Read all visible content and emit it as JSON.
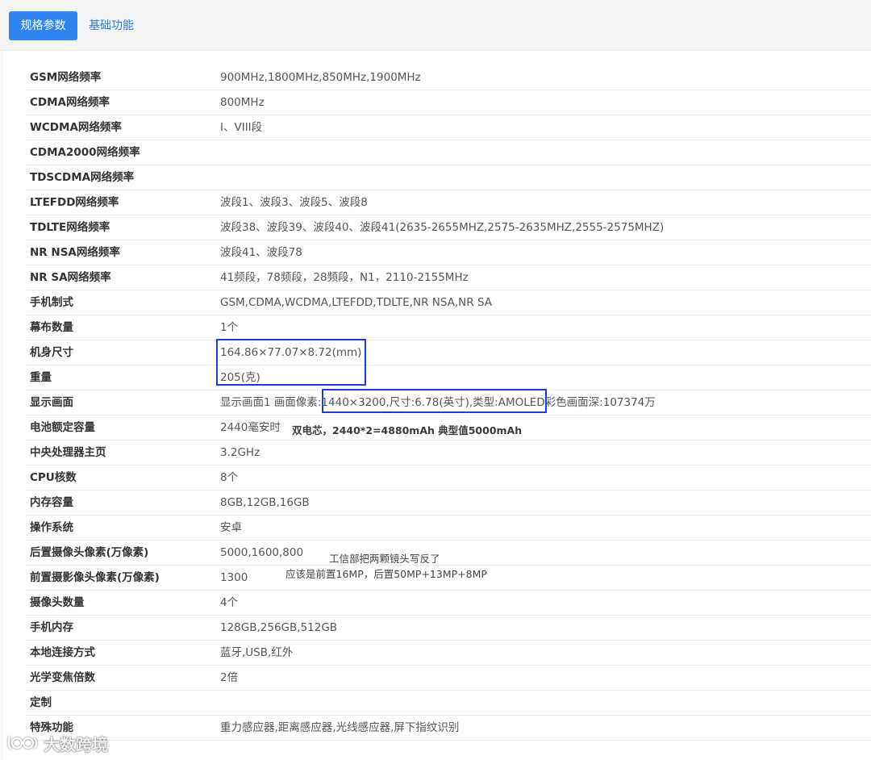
{
  "tabs": {
    "specs": "规格参数",
    "basic": "基础功能"
  },
  "rows": [
    {
      "label": "GSM网络频率",
      "value": "900MHz,1800MHz,850MHz,1900MHz"
    },
    {
      "label": "CDMA网络频率",
      "value": "800MHz"
    },
    {
      "label": "WCDMA网络频率",
      "value": "I、VIII段"
    },
    {
      "label": "CDMA2000网络频率",
      "value": ""
    },
    {
      "label": "TDSCDMA网络频率",
      "value": ""
    },
    {
      "label": "LTEFDD网络频率",
      "value": "波段1、波段3、波段5、波段8"
    },
    {
      "label": "TDLTE网络频率",
      "value": "波段38、波段39、波段40、波段41(2635-2655MHZ,2575-2635MHZ,2555-2575MHZ)"
    },
    {
      "label": "NR NSA网络频率",
      "value": "波段41、波段78"
    },
    {
      "label": "NR SA网络频率",
      "value": "41频段，78频段，28频段，N1，2110-2155MHz"
    },
    {
      "label": "手机制式",
      "value": "GSM,CDMA,WCDMA,LTEFDD,TDLTE,NR NSA,NR SA"
    },
    {
      "label": "幕布数量",
      "value": "1个"
    },
    {
      "label": "机身尺寸",
      "value": "164.86×77.07×8.72(mm)"
    },
    {
      "label": "重量",
      "value": "205(克)"
    },
    {
      "label": "显示画面",
      "value": "显示画面1 画面像素:1440×3200,尺寸:6.78(英寸),类型:AMOLED彩色画面深:107374万"
    },
    {
      "label": "电池额定容量",
      "value": "2440毫安时"
    },
    {
      "label": "中央处理器主页",
      "value": "3.2GHz"
    },
    {
      "label": "CPU核数",
      "value": "8个"
    },
    {
      "label": "内存容量",
      "value": "8GB,12GB,16GB"
    },
    {
      "label": "操作系统",
      "value": "安卓"
    },
    {
      "label": "后置摄像头像素(万像素)",
      "value": "5000,1600,800"
    },
    {
      "label": "前置摄影像头像素(万像素)",
      "value": "1300"
    },
    {
      "label": "摄像头数量",
      "value": "4个"
    },
    {
      "label": "手机内存",
      "value": "128GB,256GB,512GB"
    },
    {
      "label": "本地连接方式",
      "value": "蓝牙,USB,红外"
    },
    {
      "label": "光学变焦倍数",
      "value": "2倍"
    },
    {
      "label": "定制",
      "value": ""
    },
    {
      "label": "特殊功能",
      "value": "重力感应器,距离感应器,光线感应器,屏下指纹识别"
    }
  ],
  "annotations": {
    "battery_note": "双电芯，2440*2=4880mAh 典型值5000mAh",
    "camera_note_1": "工信部把两颗镜头写反了",
    "camera_note_2": "应该是前置16MP，后置50MP+13MP+8MP",
    "highlight_color": "#1d3fd6"
  },
  "watermark": {
    "text": "大数跨境",
    "icon": "ninety-logo-icon"
  },
  "colors": {
    "accent": "#2f86f0",
    "link": "#2f78d8"
  }
}
